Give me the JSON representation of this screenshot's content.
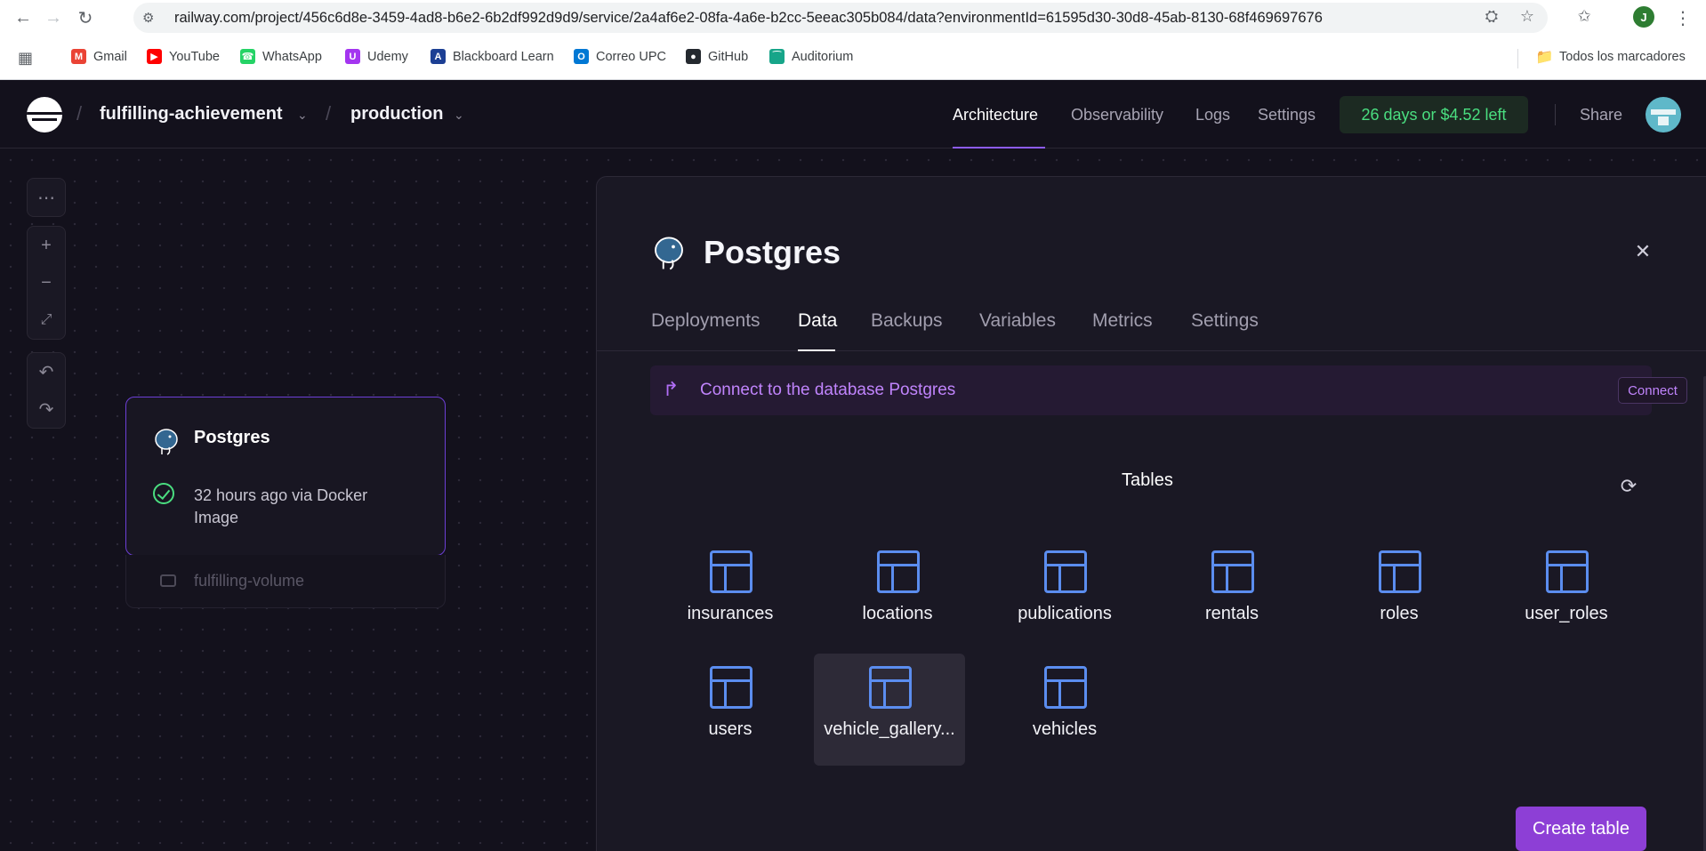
{
  "browser": {
    "url": "railway.com/project/456c6d8e-3459-4ad8-b6e2-6b2df992d9d9/service/2a4af6e2-08fa-4a6e-b2cc-5eeac305b084/data?environmentId=61595d30-30d8-45ab-8130-68f469697676",
    "profile_initial": "J",
    "bookmarks": [
      {
        "label": "Gmail",
        "icon": "gmail-icon",
        "color": "#ea4335"
      },
      {
        "label": "YouTube",
        "icon": "youtube-icon",
        "color": "#ff0000"
      },
      {
        "label": "WhatsApp",
        "icon": "whatsapp-icon",
        "color": "#25d366"
      },
      {
        "label": "Udemy",
        "icon": "udemy-icon",
        "color": "#a435f0"
      },
      {
        "label": "Blackboard Learn",
        "icon": "blackboard-icon",
        "color": "#1c3f94"
      },
      {
        "label": "Correo UPC",
        "icon": "outlook-icon",
        "color": "#0078d4"
      },
      {
        "label": "GitHub",
        "icon": "github-icon",
        "color": "#24292f"
      },
      {
        "label": "Auditorium",
        "icon": "auditorium-icon",
        "color": "#17a589"
      }
    ],
    "all_bookmarks": "Todos los marcadores"
  },
  "topbar": {
    "project": "fulfilling-achievement",
    "environment": "production",
    "nav": [
      "Architecture",
      "Observability",
      "Logs",
      "Settings"
    ],
    "active_nav": "Architecture",
    "trial": "26 days or $4.52 left",
    "share": "Share"
  },
  "canvas": {
    "service": {
      "name": "Postgres",
      "status": "32 hours ago via Docker Image",
      "volume": "fulfilling-volume"
    }
  },
  "panel": {
    "title": "Postgres",
    "tabs": [
      "Deployments",
      "Data",
      "Backups",
      "Variables",
      "Metrics",
      "Settings"
    ],
    "active_tab": "Data",
    "connect_text": "Connect to the database Postgres",
    "connect_button": "Connect",
    "tables_heading": "Tables",
    "tables": [
      "insurances",
      "locations",
      "publications",
      "rentals",
      "roles",
      "user_roles",
      "users",
      "vehicle_gallery...",
      "vehicles"
    ],
    "selected_table": "vehicle_gallery...",
    "create_button": "Create table"
  },
  "colors": {
    "accent": "#8d5cf6",
    "table_icon": "#5b8def",
    "success": "#4ade80",
    "connect_text": "#c084fc"
  }
}
